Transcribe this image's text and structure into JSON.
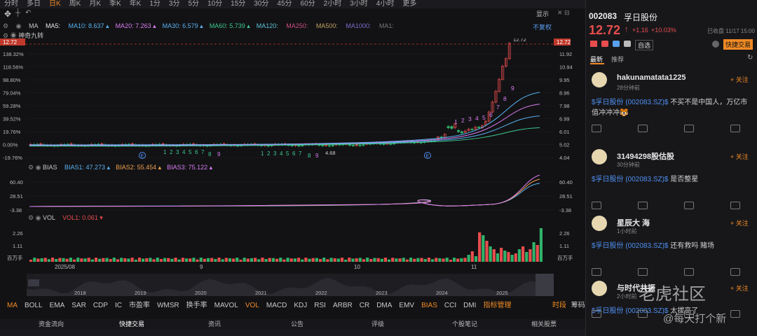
{
  "topbar": {
    "items": [
      "分时",
      "多日",
      "日K",
      "周K",
      "月K",
      "季K",
      "年K",
      "1分",
      "3分",
      "5分",
      "10分",
      "15分",
      "30分",
      "45分",
      "60分",
      "2小时",
      "3小时",
      "4小时",
      "更多"
    ],
    "active_index": 2
  },
  "toolbar": {
    "right_label": "显示",
    "right_icons": "✕ ⊟"
  },
  "ma": {
    "label": "MA",
    "items": [
      {
        "name": "MA5:",
        "value": "",
        "color": "#e8e8e8"
      },
      {
        "name": "MA10:",
        "value": "8.637",
        "color": "#56b3f0"
      },
      {
        "name": "MA20:",
        "value": "7.263",
        "color": "#d87cf0"
      },
      {
        "name": "MA30:",
        "value": "6.579",
        "color": "#5ab0f0"
      },
      {
        "name": "MA60:",
        "value": "5.739",
        "color": "#3fc88f"
      },
      {
        "name": "MA120:",
        "value": "",
        "color": "#5cc3d8"
      },
      {
        "name": "MA250:",
        "value": "",
        "color": "#c94e84"
      },
      {
        "name": "MA500:",
        "value": "",
        "color": "#c0a060"
      },
      {
        "name": "MA1000:",
        "value": "",
        "color": "#7a6ccc"
      },
      {
        "name": "MA1:",
        "value": "",
        "color": "#777"
      }
    ],
    "right": "不复权"
  },
  "indicator_label": "神奇九转",
  "price_axis_left": [
    "138.32%",
    "118.56%",
    "98.80%",
    "79.04%",
    "59.28%",
    "39.52%",
    "19.76%",
    "0.00%",
    "-19.76%"
  ],
  "price_axis_right": [
    "11.92",
    "10.94",
    "9.95",
    "8.96",
    "7.98",
    "6.99",
    "6.01",
    "5.02",
    "4.04"
  ],
  "high_price": "12.72",
  "low_price": "4.68",
  "bias": {
    "label": "BIAS",
    "items": [
      {
        "name": "BIAS1:",
        "value": "47.273",
        "color": "#5ab0f0"
      },
      {
        "name": "BIAS2:",
        "value": "55.454",
        "color": "#f0a050"
      },
      {
        "name": "BIAS3:",
        "value": "75.122",
        "color": "#d87cf0"
      }
    ],
    "axis": [
      "60.40",
      "28.51",
      "-3.38"
    ]
  },
  "vol": {
    "label": "VOL",
    "items": [
      {
        "name": "VOL1:",
        "value": "0.061",
        "color": "#e84d4d"
      }
    ],
    "axis": [
      "2.26",
      "1.11"
    ],
    "unit": "百万手"
  },
  "months": [
    "2025/08",
    "9",
    "10",
    "11"
  ],
  "years": [
    "2018",
    "2019",
    "2020",
    "2021",
    "2022",
    "2023",
    "2024",
    "2025"
  ],
  "bottom_tabs": [
    "MA",
    "BOLL",
    "EMA",
    "SAR",
    "CDP",
    "IC",
    "市盈率",
    "WMSR",
    "换手率",
    "MAVOL",
    "VOL",
    "MACD",
    "KDJ",
    "RSI",
    "ARBR",
    "CR",
    "DMA",
    "EMV",
    "BIAS",
    "CCI",
    "DMI",
    "指标管理"
  ],
  "bottom_right": [
    "时段",
    "筹码"
  ],
  "panel_tabs": [
    "资金流向",
    "快捷交易",
    "资讯",
    "公告",
    "评级",
    "个股笔记",
    "相关股票"
  ],
  "panel_active": 1,
  "stock": {
    "code": "002083",
    "name": "孚日股份",
    "price": "12.72",
    "arrow": "↑",
    "change": "+1.16",
    "pct": "+10.03%",
    "time": "已收盘 11/17 15:00",
    "watch": "自选",
    "quick": "快捷交易"
  },
  "feed_tabs": [
    "最新",
    "推荐"
  ],
  "posts": [
    {
      "user": "hakunamatata1225",
      "time": "28分钟前",
      "follow": "+ 关注",
      "link": "$孚日股份 (002083.SZ)$",
      "text": " 不买不是中国人，万亿市值冲冲冲🐯"
    },
    {
      "user": "31494298股估股",
      "time": "30分钟前",
      "follow": "+ 关注",
      "link": "$孚日股份 (002083.SZ)$",
      "text": " 是否整星"
    },
    {
      "user": "星辰大 海",
      "time": "1小时前",
      "follow": "+ 关注",
      "link": "$孚日股份 (002083.SZ)$",
      "text": " 还有救吗 赌场"
    },
    {
      "user": "与时代共振",
      "time": "2小时前",
      "follow": "+ 关注",
      "link": "$孚日股份 (002083.SZ)$",
      "text": " 太拔高了"
    }
  ],
  "watermark": {
    "brand": "老虎社区",
    "handle": "@每天打个新"
  },
  "colors": {
    "up": "#e84d4d",
    "down": "#2fb36a",
    "accent": "#f08a24"
  }
}
